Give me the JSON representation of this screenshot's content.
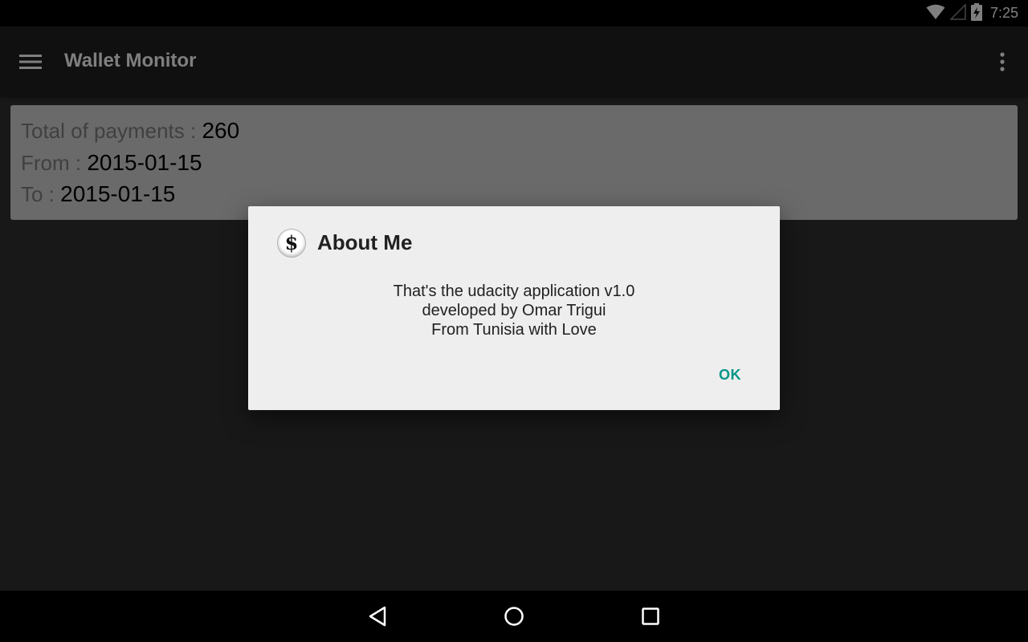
{
  "status_bar": {
    "time": "7:25",
    "icons": [
      "wifi-icon",
      "cell-signal-icon",
      "battery-charging-icon"
    ]
  },
  "app_bar": {
    "title": "Wallet Monitor",
    "menu_icon": "hamburger-menu-icon",
    "overflow_icon": "more-vert-icon"
  },
  "summary": {
    "total_label": "Total of payments : ",
    "total_value": "260",
    "from_label": "From : ",
    "from_value": "2015-01-15",
    "to_label": "To : ",
    "to_value": "2015-01-15"
  },
  "dialog": {
    "icon": "dollar-icon",
    "icon_glyph": "$",
    "title": "About Me",
    "message_lines": [
      "That's the udacity application v1.0",
      "developed by Omar Trigui",
      "From Tunisia with Love"
    ],
    "ok_label": "OK"
  },
  "nav_bar": {
    "icons": [
      "back-icon",
      "home-icon",
      "recents-icon"
    ]
  },
  "colors": {
    "accent": "#009688",
    "app_bar": "#212121",
    "background": "#303030",
    "card": "#d4d4d4"
  }
}
